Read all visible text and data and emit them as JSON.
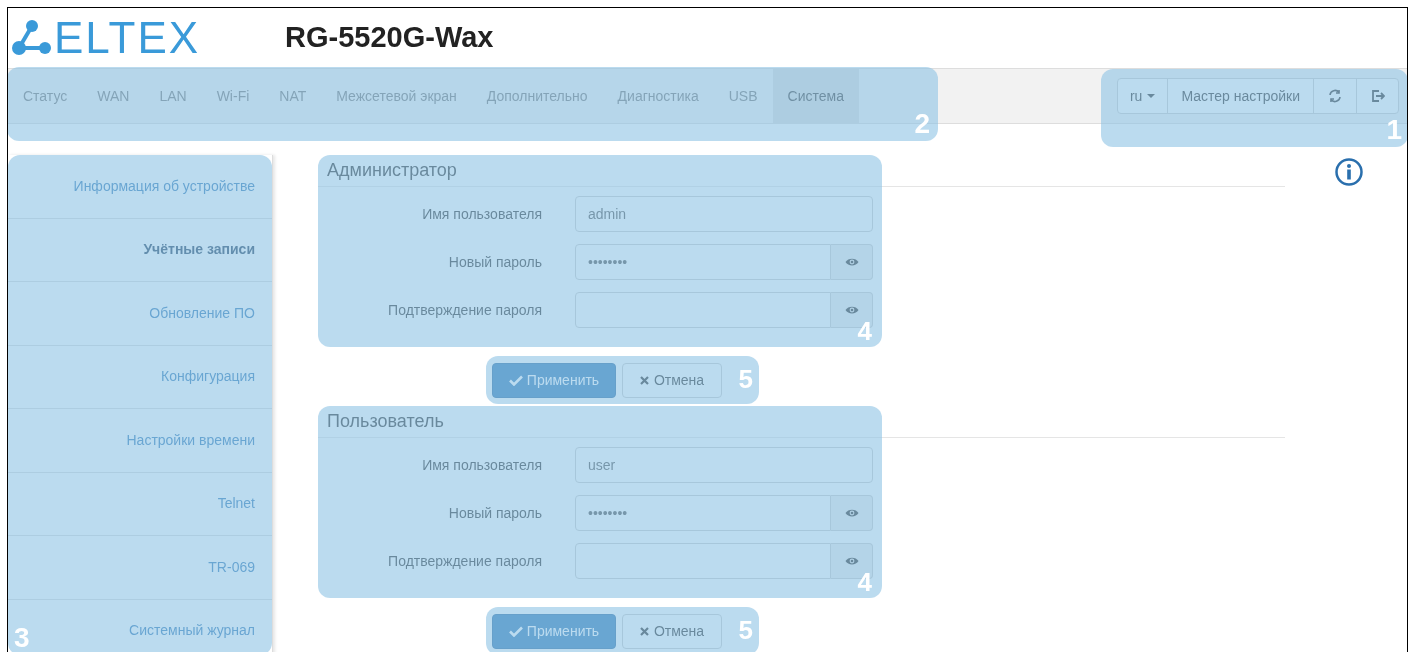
{
  "header": {
    "logo_text": "ELTEX",
    "title": "RG-5520G-Wax"
  },
  "nav": {
    "callout": "2",
    "items": [
      {
        "label": "Статус",
        "selected": false
      },
      {
        "label": "WAN",
        "selected": false
      },
      {
        "label": "LAN",
        "selected": false
      },
      {
        "label": "Wi-Fi",
        "selected": false
      },
      {
        "label": "NAT",
        "selected": false
      },
      {
        "label": "Межсетевой экран",
        "selected": false
      },
      {
        "label": "Дополнительно",
        "selected": false
      },
      {
        "label": "Диагностика",
        "selected": false
      },
      {
        "label": "USB",
        "selected": false
      },
      {
        "label": "Система",
        "selected": true
      }
    ]
  },
  "toolbar": {
    "callout": "1",
    "language": "ru",
    "wizard": "Мастер настройки"
  },
  "sidebar": {
    "callout": "3",
    "items": [
      {
        "label": "Информация об устройстве",
        "selected": false
      },
      {
        "label": "Учётные записи",
        "selected": true
      },
      {
        "label": "Обновление ПО",
        "selected": false
      },
      {
        "label": "Конфигурация",
        "selected": false
      },
      {
        "label": "Настройки времени",
        "selected": false
      },
      {
        "label": "Telnet",
        "selected": false
      },
      {
        "label": "TR-069",
        "selected": false
      },
      {
        "label": "Системный журнал",
        "selected": false
      }
    ]
  },
  "sections": [
    {
      "title": "Администратор",
      "callout": "4",
      "fields": [
        {
          "kind": "text",
          "label": "Имя пользователя",
          "value": "admin"
        },
        {
          "kind": "password",
          "label": "Новый пароль",
          "value": "••••••••"
        },
        {
          "kind": "password",
          "label": "Подтверждение пароля"
        }
      ],
      "apply": "Применить",
      "cancel": "Отмена",
      "buttons_callout": "5"
    },
    {
      "title": "Пользователь",
      "callout": "4",
      "fields": [
        {
          "kind": "text",
          "label": "Имя пользователя",
          "value": "user"
        },
        {
          "kind": "password",
          "label": "Новый пароль",
          "value": "••••••••"
        },
        {
          "kind": "password",
          "label": "Подтверждение пароля"
        }
      ],
      "apply": "Применить",
      "cancel": "Отмена",
      "buttons_callout": "5"
    }
  ]
}
